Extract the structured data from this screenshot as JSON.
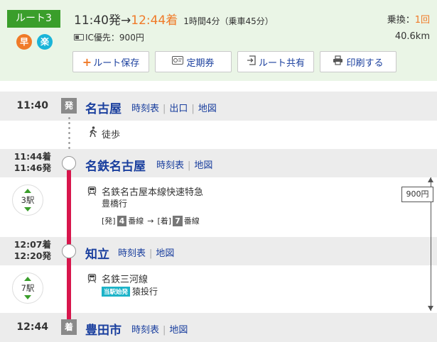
{
  "route": {
    "label": "ルート3",
    "badges": [
      "早",
      "楽"
    ],
    "depart": "11:40発",
    "arrow": "→",
    "arrive": "12:44着",
    "duration": "1時間4分（乗車45分）",
    "ic_fare": "IC優先：900円",
    "transfer_label": "乗換：",
    "transfer_count": "1回",
    "distance": "40.6km"
  },
  "actions": {
    "save": "ルート保存",
    "pass": "定期券",
    "share": "ルート共有",
    "print": "印刷する"
  },
  "stations": [
    {
      "time": "11:40",
      "tag": "発",
      "name": "名古屋",
      "links": [
        "時刻表",
        "出口",
        "地図"
      ]
    },
    {
      "time_arr": "11:44着",
      "time_dep": "11:46発",
      "name": "名鉄名古屋",
      "links": [
        "時刻表",
        "地図"
      ]
    },
    {
      "time_arr": "12:07着",
      "time_dep": "12:20発",
      "name": "知立",
      "links": [
        "時刻表",
        "地図"
      ]
    },
    {
      "time": "12:44",
      "tag": "着",
      "name": "豊田市",
      "links": [
        "時刻表",
        "地図"
      ]
    }
  ],
  "walk": {
    "label": "徒歩"
  },
  "segments": [
    {
      "stops": "3駅",
      "line": "名鉄名古屋本線快速特急",
      "dest": "豊橋行",
      "platform": {
        "dep_label": "[発]",
        "dep_num": "4",
        "dep_suffix": "番線",
        "arrow": "→",
        "arr_label": "[着]",
        "arr_num": "7",
        "arr_suffix": "番線"
      }
    },
    {
      "stops": "7駅",
      "line": "名鉄三河線",
      "tag": "当駅始発",
      "dest": "猿投行"
    }
  ],
  "fare": "900円",
  "colors": {
    "accent_green": "#3a9e2b",
    "accent_orange": "#f07a28",
    "line_red": "#d8164c",
    "link_blue": "#1a3f9e"
  }
}
